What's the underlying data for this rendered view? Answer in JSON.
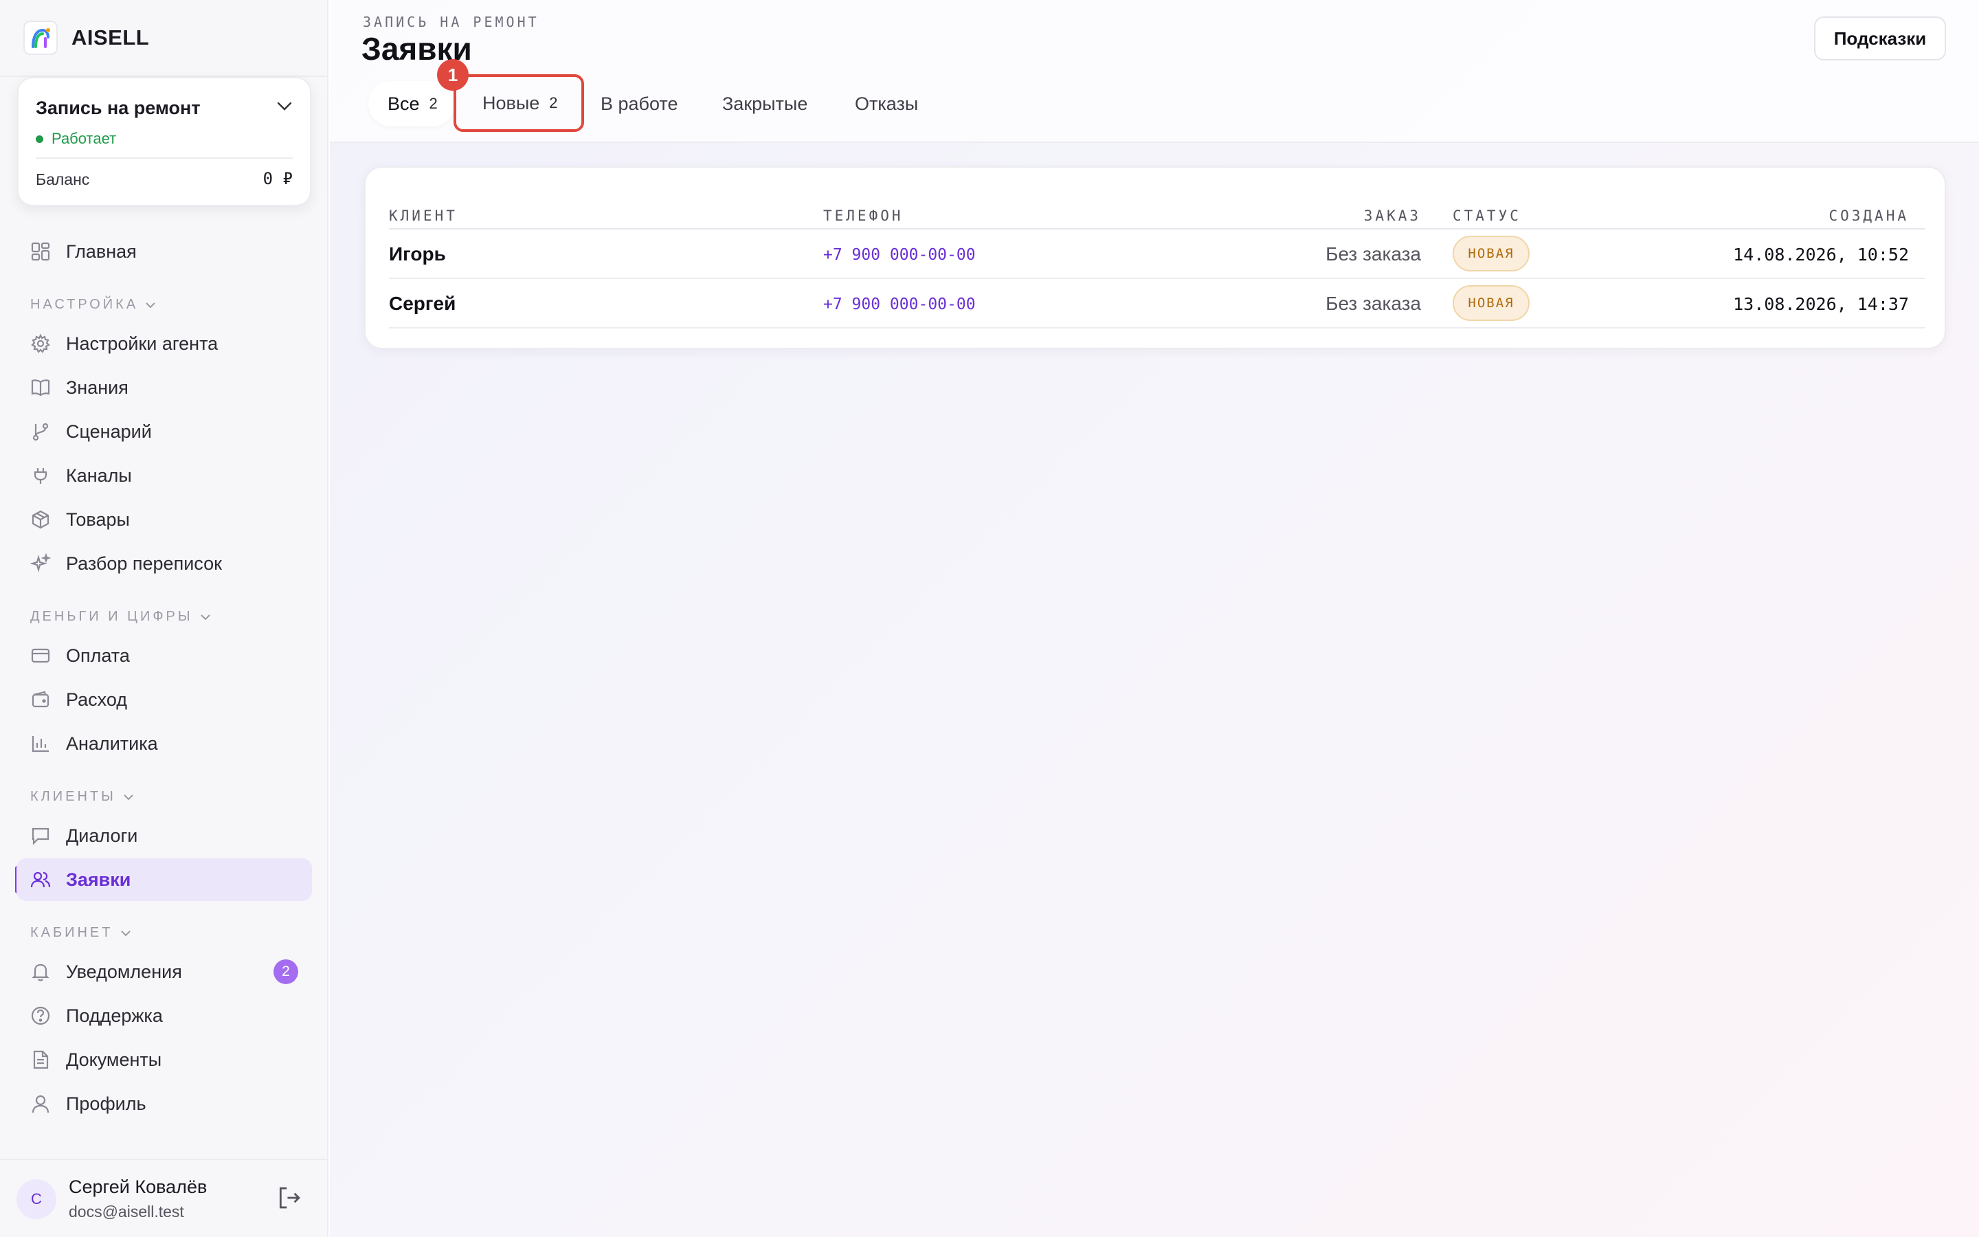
{
  "brand": {
    "name": "AISELL"
  },
  "agent": {
    "name": "Запись на ремонт",
    "status": "Работает",
    "balance_label": "Баланс",
    "balance_value": "0 ₽"
  },
  "nav": {
    "home": "Главная",
    "settings_section": "НАСТРОЙКА",
    "settings_items": [
      "Настройки агента",
      "Знания",
      "Сценарий",
      "Каналы",
      "Товары",
      "Разбор переписок"
    ],
    "money_section": "ДЕНЬГИ И ЦИФРЫ",
    "money_items": [
      "Оплата",
      "Расход",
      "Аналитика"
    ],
    "clients_section": "КЛИЕНТЫ",
    "clients_items": [
      "Диалоги",
      "Заявки"
    ],
    "cabinet_section": "КАБИНЕТ",
    "cabinet_items": [
      "Уведомления",
      "Поддержка",
      "Документы",
      "Профиль"
    ],
    "notifications_count": "2",
    "active_item": "Заявки"
  },
  "user": {
    "initial": "С",
    "name": "Сергей Ковалёв",
    "email": "docs@aisell.test"
  },
  "header": {
    "breadcrumb": "ЗАПИСЬ НА РЕМОНТ",
    "title": "Заявки",
    "hints_button": "Подсказки"
  },
  "tabs": [
    {
      "label": "Все",
      "count": "2"
    },
    {
      "label": "Новые",
      "count": "2"
    },
    {
      "label": "В работе"
    },
    {
      "label": "Закрытые"
    },
    {
      "label": "Отказы"
    }
  ],
  "tab_marker": "1",
  "table": {
    "columns": [
      "КЛИЕНТ",
      "ТЕЛЕФОН",
      "ЗАКАЗ",
      "СТАТУС",
      "СОЗДАНА"
    ],
    "rows": [
      {
        "client": "Игорь",
        "phone": "+7 900 000-00-00",
        "order": "Без заказа",
        "status": "НОВАЯ",
        "created": "14.08.2026, 10:52"
      },
      {
        "client": "Сергей",
        "phone": "+7 900 000-00-00",
        "order": "Без заказа",
        "status": "НОВАЯ",
        "created": "13.08.2026, 14:37"
      }
    ]
  },
  "colors": {
    "accent": "#7c3aed",
    "status_ok": "#1f9a4a",
    "highlight": "#e0483d",
    "badge_new_bg": "#fbeedd"
  }
}
